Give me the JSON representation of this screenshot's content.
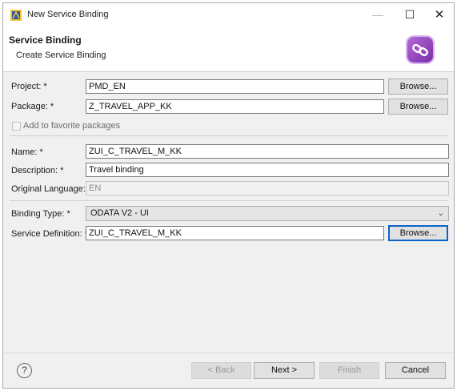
{
  "window": {
    "title": "New Service Binding"
  },
  "header": {
    "title": "Service Binding",
    "subtitle": "Create Service Binding"
  },
  "form": {
    "project_label": "Project: *",
    "project_value": "PMD_EN",
    "package_label": "Package: *",
    "package_value": "Z_TRAVEL_APP_KK",
    "favorite_label": "Add to favorite packages",
    "name_label": "Name: *",
    "name_value": "ZUI_C_TRAVEL_M_KK",
    "description_label": "Description: *",
    "description_value": "Travel binding",
    "language_label": "Original Language:",
    "language_value": "EN",
    "binding_type_label": "Binding Type: *",
    "binding_type_value": "ODATA V2 - UI",
    "service_def_label": "Service Definition: *",
    "service_def_value": "ZUI_C_TRAVEL_M_KK",
    "browse_label": "Browse..."
  },
  "footer": {
    "help": "?",
    "back": "< Back",
    "next": "Next >",
    "finish": "Finish",
    "cancel": "Cancel"
  },
  "icons": {
    "app": "eclipse-wizard-icon",
    "header": "service-binding-link-icon"
  },
  "colors": {
    "accent": "#9a4dc8",
    "focus": "#0a64c8"
  }
}
